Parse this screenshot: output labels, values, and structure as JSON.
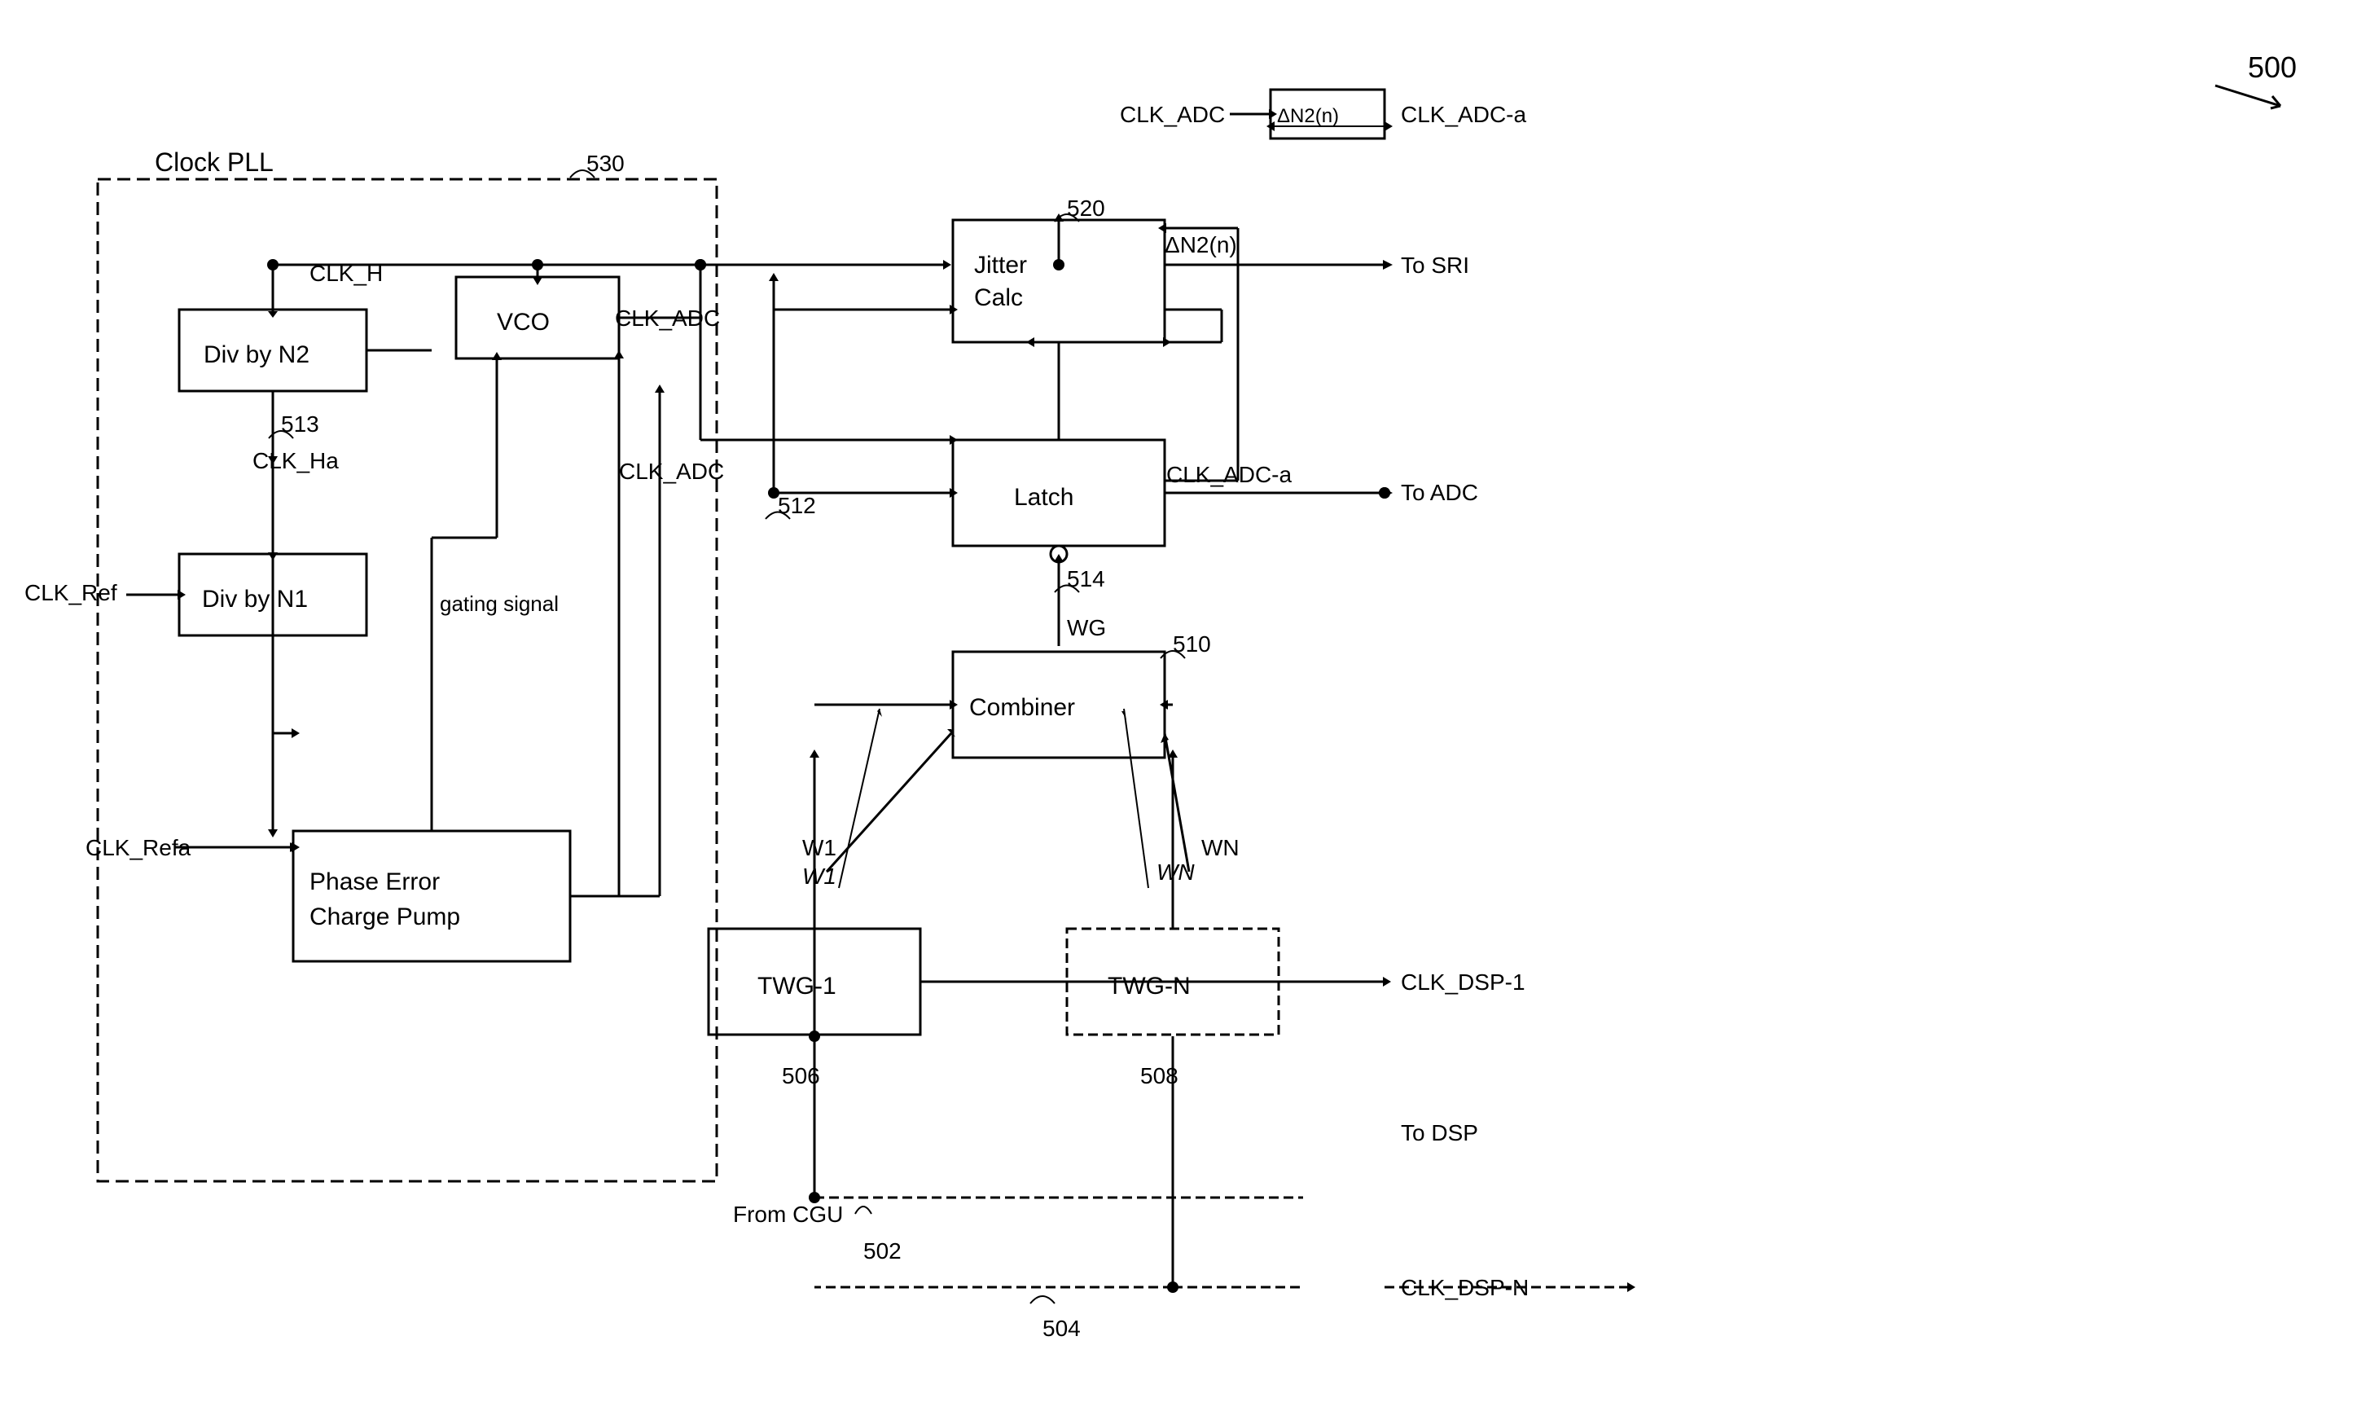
{
  "diagram": {
    "title": "500",
    "blocks": {
      "clock_pll_label": "Clock PLL",
      "clock_pll_ref": "530",
      "div_by_n2": "Div by N2",
      "div_by_n2_ref": "513",
      "div_by_n1": "Div by N1",
      "vco": "VCO",
      "phase_error": "Phase Error\nCharge Pump",
      "jitter_calc": "Jitter\nCalc",
      "jitter_ref": "520",
      "latch": "Latch",
      "combiner": "Combiner",
      "combiner_ref": "510",
      "twg1": "TWG-1",
      "twg1_ref": "506",
      "twgn": "TWG-N",
      "twgn_ref": "508",
      "signals": {
        "clk_h": "CLK_H",
        "clk_ha": "CLK_Ha",
        "clk_ref": "CLK_Ref",
        "clk_refa": "CLK_Refa",
        "clk_adc_top": "CLK_ADC",
        "delta_n2_top": "ΔN2(n)",
        "clk_adc_a_top": "CLK_ADC-a",
        "clk_adc": "CLK_ADC",
        "clk_adc_a": "CLK_ADC-a",
        "delta_n2": "ΔN2(n)",
        "to_sri": "To SRI",
        "to_adc": "To ADC",
        "wg": "WG",
        "w1": "W1",
        "wn": "WN",
        "gating_signal": "gating signal",
        "from_cgu": "From CGU",
        "clk_dsp1": "CLK_DSP-1",
        "clk_dspn": "CLK_DSP-N",
        "to_dsp": "To DSP",
        "ref_512": "512",
        "ref_514": "514",
        "ref_502": "502",
        "ref_504": "504"
      }
    }
  }
}
